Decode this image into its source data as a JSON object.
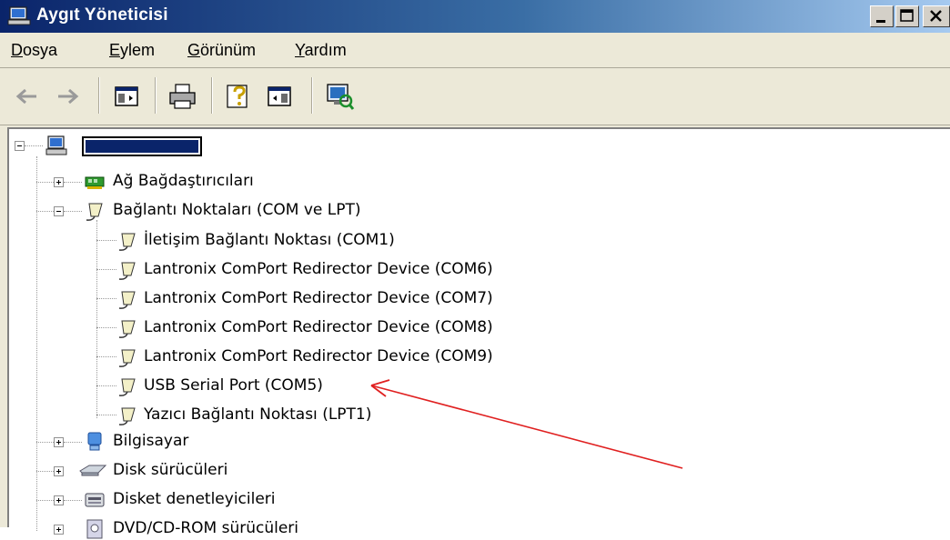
{
  "window": {
    "title": "Aygıt Yöneticisi"
  },
  "menu": [
    {
      "label": "Dosya",
      "accel": "D",
      "rest": "osya"
    },
    {
      "label": "Eylem",
      "accel": "E",
      "rest": "ylem"
    },
    {
      "label": "Görünüm",
      "accel": "G",
      "rest": "örünüm"
    },
    {
      "label": "Yardım",
      "accel": "Y",
      "rest": "ardım"
    }
  ],
  "tree": {
    "categories": [
      {
        "label": "Ağ Bağdaştırıcıları",
        "expanded": false
      },
      {
        "label": "Bağlantı Noktaları (COM ve LPT)",
        "expanded": true,
        "children": [
          "İletişim Bağlantı Noktası (COM1)",
          "Lantronix ComPort Redirector Device (COM6)",
          "Lantronix ComPort Redirector Device (COM7)",
          "Lantronix ComPort Redirector Device (COM8)",
          "Lantronix ComPort Redirector Device (COM9)",
          "USB Serial Port (COM5)",
          "Yazıcı Bağlantı Noktası (LPT1)"
        ]
      },
      {
        "label": "Bilgisayar",
        "expanded": false
      },
      {
        "label": "Disk sürücüleri",
        "expanded": false
      },
      {
        "label": "Disket denetleyicileri",
        "expanded": false
      },
      {
        "label": "DVD/CD-ROM sürücüleri",
        "expanded": false
      }
    ]
  },
  "colors": {
    "titlebar_start": "#0a246a",
    "annotation_arrow": "#e02020",
    "selection": "#0a246a"
  },
  "icons": [
    "computer-icon",
    "network-adapter-icon",
    "port-connector-icon",
    "monitor-icon",
    "disk-drive-icon",
    "floppy-controller-icon",
    "dvd-drive-icon"
  ]
}
